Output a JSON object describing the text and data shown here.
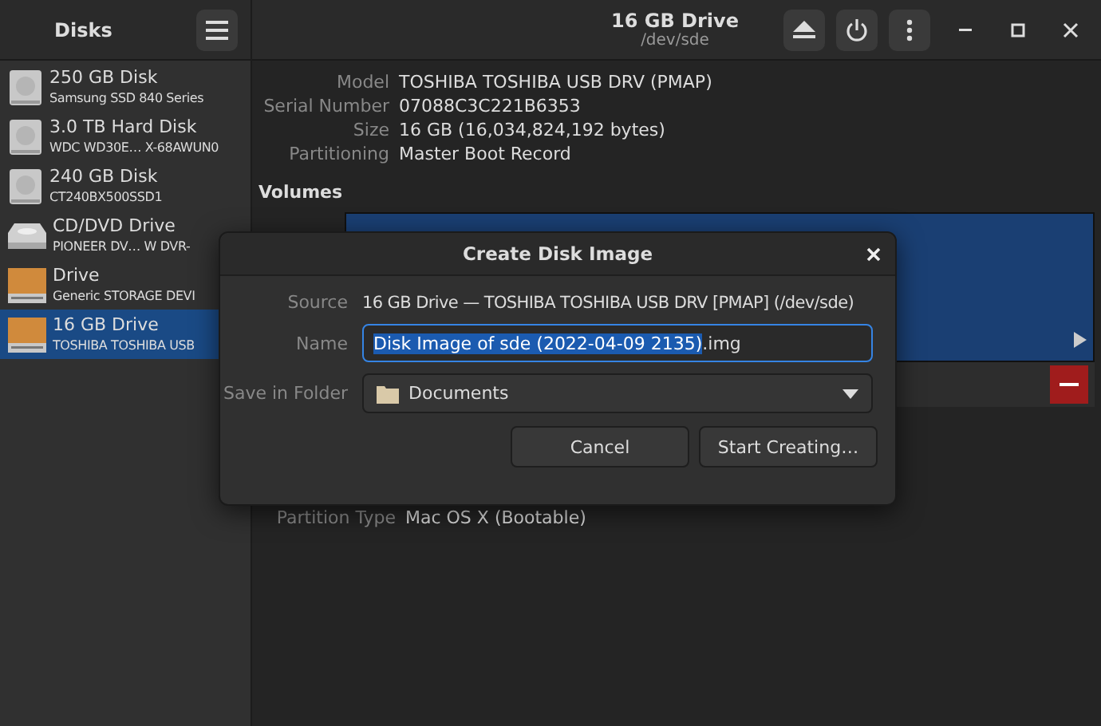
{
  "header": {
    "sidebar_title": "Disks",
    "title": "16 GB Drive",
    "subtitle": "/dev/sde"
  },
  "disks": [
    {
      "name": "250 GB Disk",
      "detail": "Samsung SSD 840 Series",
      "kind": "hdd",
      "selected": false
    },
    {
      "name": "3.0 TB Hard Disk",
      "detail": "WDC WD30E… X-68AWUN0",
      "kind": "hdd",
      "selected": false
    },
    {
      "name": "240 GB Disk",
      "detail": "CT240BX500SSD1",
      "kind": "hdd",
      "selected": false
    },
    {
      "name": "CD/DVD Drive",
      "detail": "PIONEER DV…  W  DVR-",
      "kind": "optical",
      "selected": false
    },
    {
      "name": "Drive",
      "detail": "Generic STORAGE DEVI",
      "kind": "usb",
      "selected": false
    },
    {
      "name": "16 GB Drive",
      "detail": "TOSHIBA TOSHIBA USB",
      "kind": "usb",
      "selected": true
    }
  ],
  "drive_info": [
    {
      "label": "Model",
      "value": "TOSHIBA TOSHIBA USB DRV (PMAP)"
    },
    {
      "label": "Serial Number",
      "value": "07088C3C221B6353"
    },
    {
      "label": "Size",
      "value": "16 GB (16,034,824,192 bytes)"
    },
    {
      "label": "Partitioning",
      "value": "Master Boot Record"
    }
  ],
  "volumes": {
    "heading": "Volumes"
  },
  "volume_info": [
    {
      "label": "Partition Type",
      "value": "Mac OS X (Bootable)"
    }
  ],
  "dialog": {
    "title": "Create Disk Image",
    "rows": [
      {
        "kind": "text",
        "label": "Source",
        "value": "16 GB Drive — TOSHIBA TOSHIBA USB DRV [PMAP] (/dev/sde)"
      },
      {
        "kind": "input",
        "label": "Name",
        "selected_text": "Disk Image of sde (2022-04-09 2135)",
        "rest_text": ".img"
      },
      {
        "kind": "select",
        "label": "Save in Folder",
        "value": "Documents"
      }
    ],
    "buttons": [
      "Cancel",
      "Start Creating…"
    ]
  }
}
